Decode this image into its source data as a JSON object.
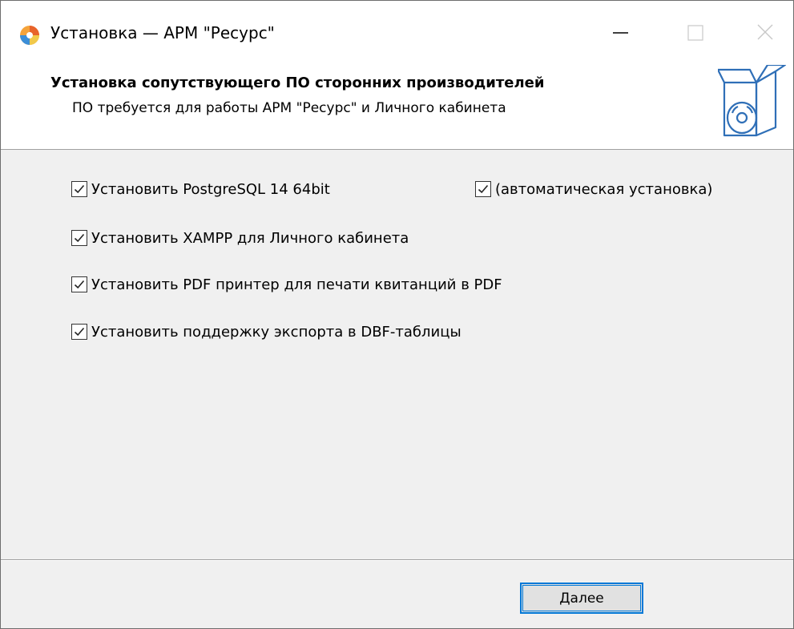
{
  "window": {
    "title": "Установка — АРМ \"Ресурс\"",
    "controls": {
      "minimize": "minimize",
      "maximize": "maximize",
      "close": "close"
    }
  },
  "header": {
    "title": "Установка сопутствующего ПО сторонних производителей",
    "subtitle": "ПО требуется для работы АРМ \"Ресурс\" и Личного кабинета",
    "icon": "box-with-disc-icon"
  },
  "options": [
    {
      "label": "Установить PostgreSQL 14 64bit",
      "checked": true
    },
    {
      "label": "(автоматическая установка)",
      "checked": true
    },
    {
      "label": "Установить XAMPP для Личного кабинета",
      "checked": true
    },
    {
      "label": "Установить PDF принтер для печати квитанций в PDF",
      "checked": true
    },
    {
      "label": "Установить поддержку экспорта в DBF-таблицы",
      "checked": true
    }
  ],
  "footer": {
    "next_label": "Далее"
  },
  "colors": {
    "accent": "#0078d7",
    "dialog_bg": "#f0f0f0",
    "header_bg": "#ffffff"
  }
}
